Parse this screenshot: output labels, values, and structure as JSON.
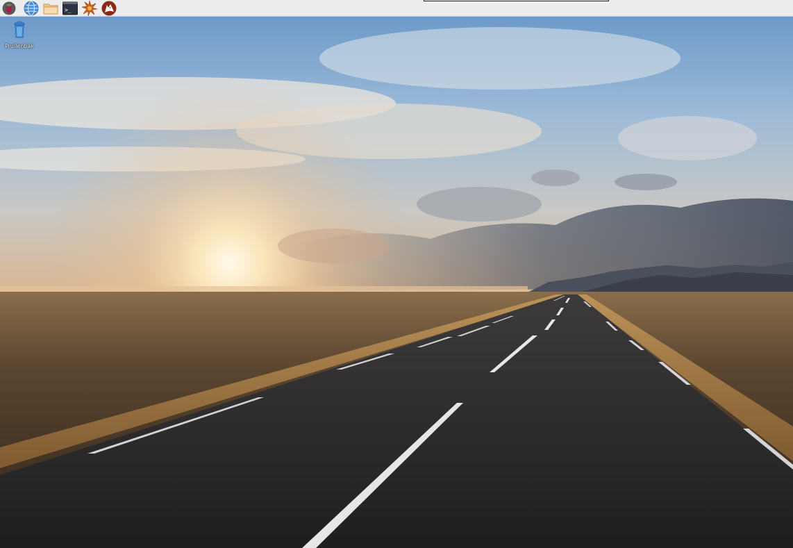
{
  "panel": {
    "launchers": [
      {
        "name": "menu-launcher",
        "icon": "raspberry-icon"
      },
      {
        "name": "web-browser-launcher",
        "icon": "globe-icon"
      },
      {
        "name": "file-manager-launcher",
        "icon": "folder-icon"
      },
      {
        "name": "terminal-launcher",
        "icon": "terminal-icon"
      },
      {
        "name": "math-app-launcher",
        "icon": "starburst-icon"
      },
      {
        "name": "wolfram-launcher",
        "icon": "wolf-icon"
      }
    ],
    "terminal_prompt": ">_"
  },
  "desktop": {
    "wallpaper": "road-sunset",
    "icons": [
      {
        "label": "Prullenbak",
        "icon": "trash-icon"
      }
    ]
  },
  "colors": {
    "panel_bg": "#ededed",
    "sky_top": "#5f8fc4",
    "sun": "#fff4d8",
    "field": "#6b5233",
    "road": "#2a2828",
    "lane_mark": "#e8e8e8"
  }
}
